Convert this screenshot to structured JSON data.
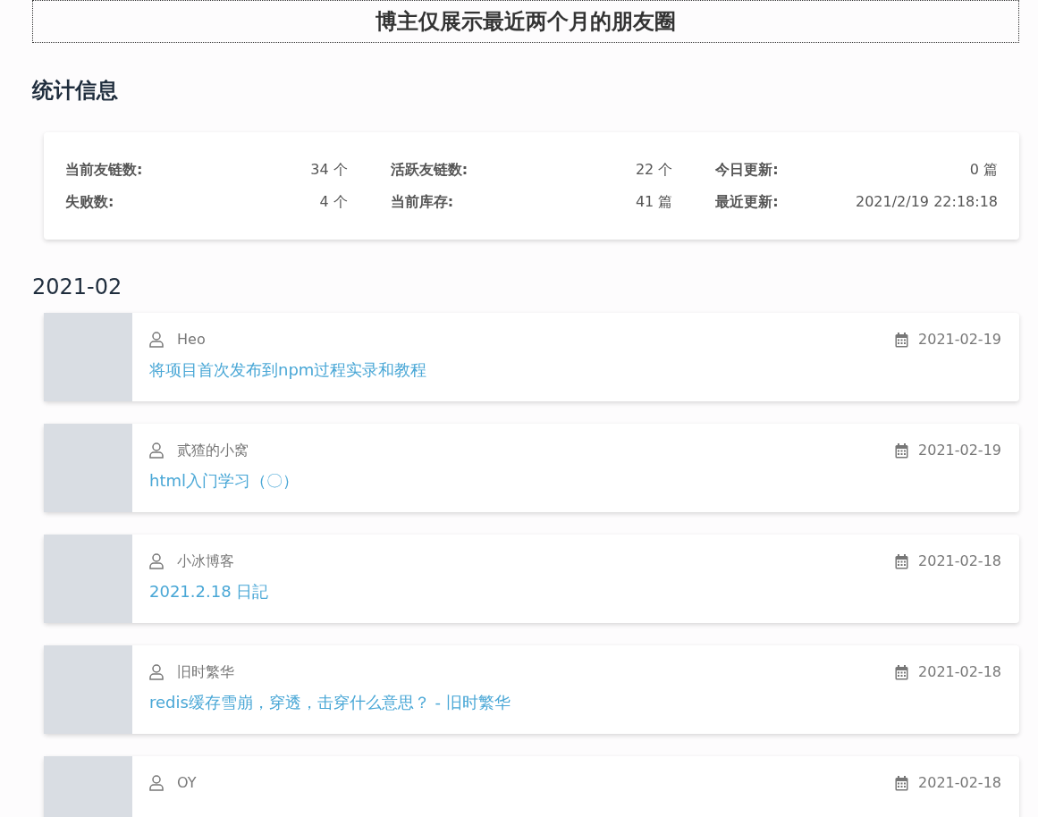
{
  "banner": {
    "title": "博主仅展示最近两个月的朋友圈"
  },
  "stats": {
    "heading": "统计信息",
    "items": [
      {
        "label": "当前友链数:",
        "value": "34 个"
      },
      {
        "label": "活跃友链数:",
        "value": "22 个"
      },
      {
        "label": "今日更新:",
        "value": "0 篇"
      },
      {
        "label": "失败数:",
        "value": "4 个"
      },
      {
        "label": "当前库存:",
        "value": "41 篇"
      },
      {
        "label": "最近更新:",
        "value": "2021/2/19 22:18:18"
      }
    ]
  },
  "month": {
    "heading": "2021-02",
    "posts": [
      {
        "author": "Heo",
        "date": "2021-02-19",
        "title": "将项目首次发布到npm过程实录和教程"
      },
      {
        "author": "贰猹的小窝",
        "date": "2021-02-19",
        "title": "html入门学习（〇）"
      },
      {
        "author": "小冰博客",
        "date": "2021-02-18",
        "title": "2021.2.18 日記"
      },
      {
        "author": "旧时繁华",
        "date": "2021-02-18",
        "title": "redis缓存雪崩，穿透，击穿什么意思？ - 旧时繁华"
      },
      {
        "author": "OY",
        "date": "2021-02-18"
      }
    ]
  }
}
